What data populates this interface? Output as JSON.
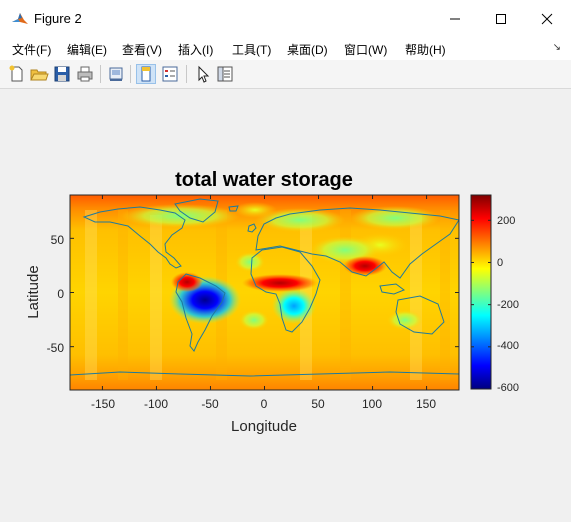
{
  "window": {
    "title": "Figure 2"
  },
  "menu": {
    "items": [
      "文件(F)",
      "编辑(E)",
      "查看(V)",
      "插入(I)",
      "工具(T)",
      "桌面(D)",
      "窗口(W)",
      "帮助(H)"
    ],
    "overflow_icon": "chevron-icon"
  },
  "toolbar": {
    "icons": [
      "new-figure-icon",
      "open-file-icon",
      "save-icon",
      "print-icon",
      "link-icon",
      "plot-tools-icon",
      "legend-icon",
      "pointer-icon",
      "property-inspector-icon"
    ]
  },
  "plot": {
    "title": "total water storage",
    "xlabel": "Longitude",
    "ylabel": "Latitude",
    "xticks": [
      "-150",
      "-100",
      "-50",
      "0",
      "50",
      "100",
      "150"
    ],
    "yticks": [
      "50",
      "0",
      "-50"
    ],
    "colorbar_ticks": [
      "200",
      "0",
      "-200",
      "-400",
      "-600"
    ]
  },
  "chart_data": {
    "type": "heatmap",
    "title": "total water storage",
    "xlabel": "Longitude",
    "ylabel": "Latitude",
    "xlim": [
      -180,
      180
    ],
    "ylim": [
      -90,
      90
    ],
    "xticks": [
      -150,
      -100,
      -50,
      0,
      50,
      100,
      150
    ],
    "yticks": [
      -50,
      0,
      50
    ],
    "colormap": "jet",
    "colorbar": {
      "range": [
        -600,
        320
      ],
      "ticks": [
        200,
        0,
        -200,
        -400,
        -600
      ]
    },
    "coastlines": true,
    "features": [
      {
        "region": "central Amazon",
        "lon": -60,
        "lat": -8,
        "value": -600
      },
      {
        "region": "southeast Africa",
        "lon": 25,
        "lat": -15,
        "value": -350
      },
      {
        "region": "northwest Amazon",
        "lon": -68,
        "lat": 7,
        "value": 280
      },
      {
        "region": "Sahel",
        "lon": 10,
        "lat": 10,
        "value": 300
      },
      {
        "region": "north India",
        "lon": 88,
        "lat": 26,
        "value": 310
      }
    ]
  }
}
